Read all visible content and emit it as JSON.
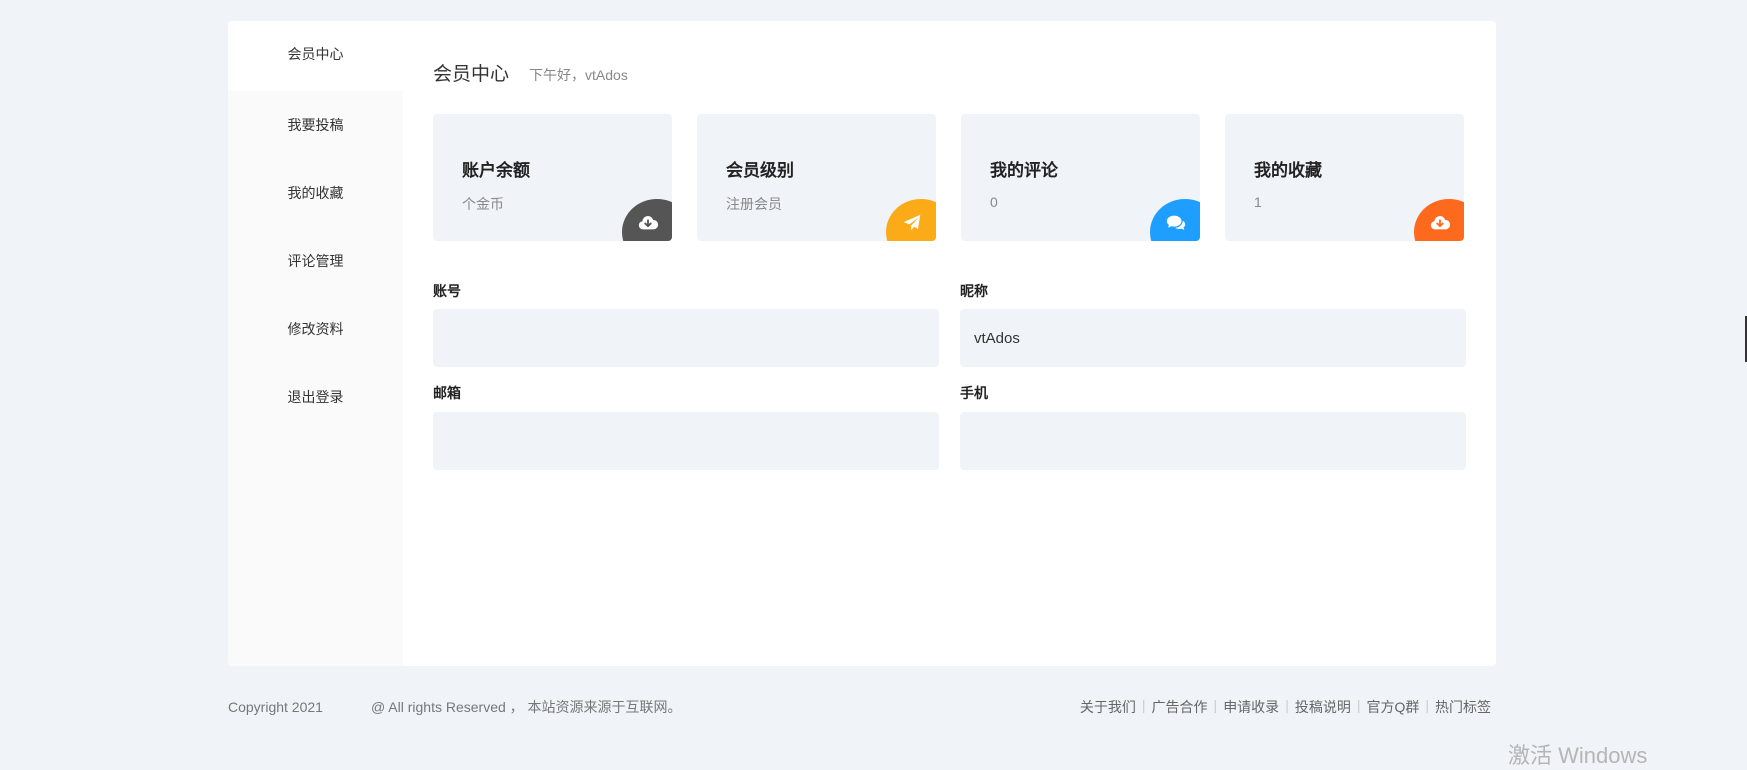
{
  "sidebar": {
    "items": [
      {
        "label": "会员中心"
      },
      {
        "label": "我要投稿"
      },
      {
        "label": "我的收藏"
      },
      {
        "label": "评论管理"
      },
      {
        "label": "修改资料"
      },
      {
        "label": "退出登录"
      }
    ]
  },
  "header": {
    "title": "会员中心",
    "greeting": "下午好，vtAdos"
  },
  "cards": [
    {
      "title": "账户余额",
      "value": "个金币",
      "icon": "cloud-download-icon",
      "color": "#555555"
    },
    {
      "title": "会员级别",
      "value": "注册会员",
      "icon": "paper-plane-icon",
      "color": "#fbab18"
    },
    {
      "title": "我的评论",
      "value": "0",
      "icon": "comments-icon",
      "color": "#1e9fff"
    },
    {
      "title": "我的收藏",
      "value": "1",
      "icon": "cloud-download-icon",
      "color": "#fd6a1d"
    }
  ],
  "form": {
    "account_label": "账号",
    "account_value": "",
    "nickname_label": "昵称",
    "nickname_value": "vtAdos",
    "email_label": "邮箱",
    "email_value": "",
    "phone_label": "手机",
    "phone_value": ""
  },
  "footer": {
    "copyright": "Copyright 2021",
    "rights": "@ All rights Reserved ， 本站资源来源于互联网。",
    "links": [
      "关于我们",
      "广告合作",
      "申请收录",
      "投稿说明",
      "官方Q群",
      "热门标签"
    ]
  },
  "watermark": "激活 Windows"
}
